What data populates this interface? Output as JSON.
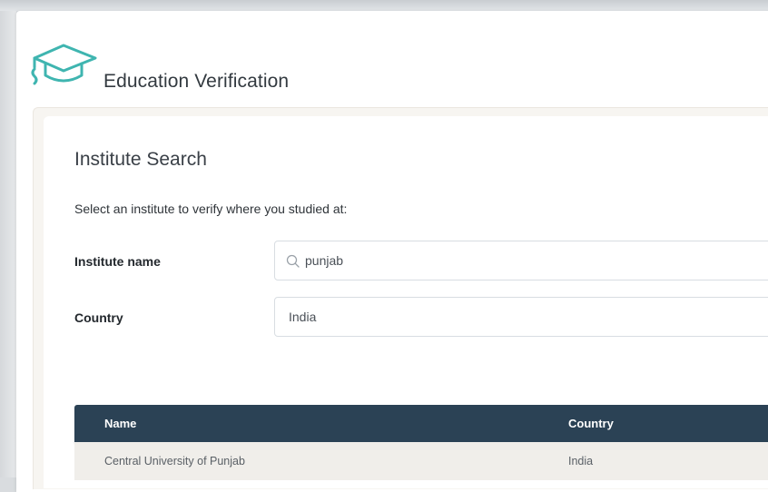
{
  "header": {
    "title": "Education Verification",
    "icon": "graduation-cap-icon",
    "accent_color": "#3fb5b0"
  },
  "search": {
    "title": "Institute Search",
    "instructions": "Select an institute to verify where you studied at:",
    "institute_label": "Institute name",
    "institute_value": "punjab",
    "country_label": "Country",
    "country_value": "India"
  },
  "table": {
    "header_color": "#2b4255",
    "columns": [
      "Name",
      "Country"
    ],
    "rows": [
      [
        "Central University of Punjab",
        "India"
      ]
    ]
  }
}
